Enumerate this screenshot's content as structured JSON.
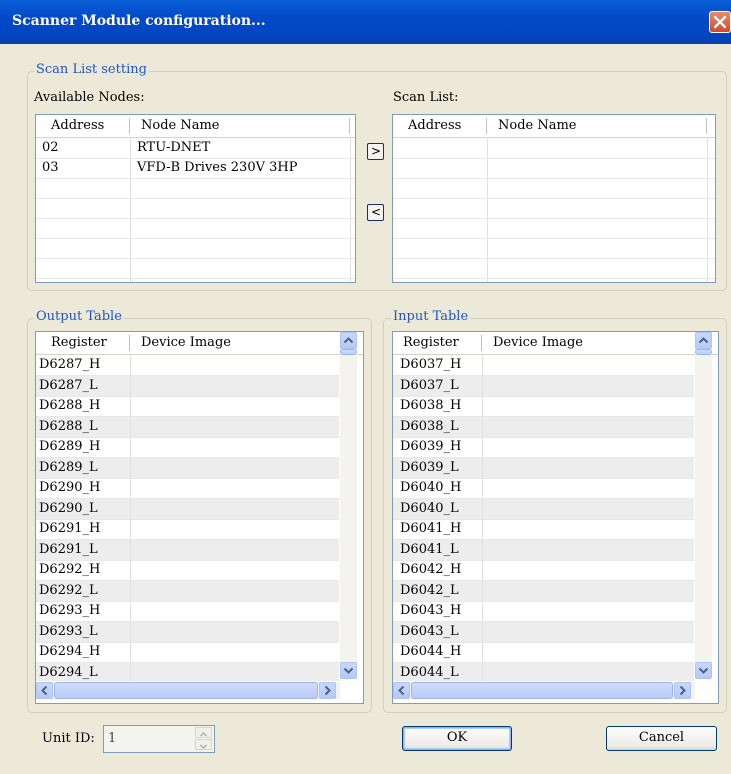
{
  "window": {
    "title": "Scanner Module configuration..."
  },
  "scan_list_group": {
    "legend": "Scan List setting"
  },
  "available_nodes": {
    "label": "Available Nodes:",
    "columns": [
      "Address",
      "Node Name"
    ],
    "rows": [
      {
        "address": "02",
        "name": "RTU-DNET"
      },
      {
        "address": "03",
        "name": "VFD-B Drives 230V 3HP"
      },
      {
        "address": "",
        "name": ""
      },
      {
        "address": "",
        "name": ""
      },
      {
        "address": "",
        "name": ""
      },
      {
        "address": "",
        "name": ""
      }
    ]
  },
  "move_buttons": {
    "add": ">",
    "remove": "<"
  },
  "scan_list": {
    "label": "Scan List:",
    "columns": [
      "Address",
      "Node Name"
    ],
    "rows": [
      {
        "address": "",
        "name": ""
      },
      {
        "address": "",
        "name": ""
      },
      {
        "address": "",
        "name": ""
      },
      {
        "address": "",
        "name": ""
      },
      {
        "address": "",
        "name": ""
      },
      {
        "address": "",
        "name": ""
      },
      {
        "address": "",
        "name": ""
      }
    ]
  },
  "output_table": {
    "legend": "Output Table",
    "columns": [
      "Register",
      "Device Image"
    ],
    "rows": [
      "D6287_H",
      "D6287_L",
      "D6288_H",
      "D6288_L",
      "D6289_H",
      "D6289_L",
      "D6290_H",
      "D6290_L",
      "D6291_H",
      "D6291_L",
      "D6292_H",
      "D6292_L",
      "D6293_H",
      "D6293_L",
      "D6294_H",
      "D6294_L"
    ]
  },
  "input_table": {
    "legend": "Input Table",
    "columns": [
      "Register",
      "Device Image"
    ],
    "rows": [
      "D6037_H",
      "D6037_L",
      "D6038_H",
      "D6038_L",
      "D6039_H",
      "D6039_L",
      "D6040_H",
      "D6040_L",
      "D6041_H",
      "D6041_L",
      "D6042_H",
      "D6042_L",
      "D6043_H",
      "D6043_L",
      "D6044_H",
      "D6044_L"
    ]
  },
  "unit_id": {
    "label": "Unit ID:",
    "value": "1"
  },
  "buttons": {
    "ok": "OK",
    "cancel": "Cancel"
  },
  "icons": [
    "close-icon",
    "scroll-up-icon",
    "scroll-down-icon",
    "scroll-left-icon",
    "scroll-right-icon",
    "spin-up-icon",
    "spin-down-icon"
  ]
}
